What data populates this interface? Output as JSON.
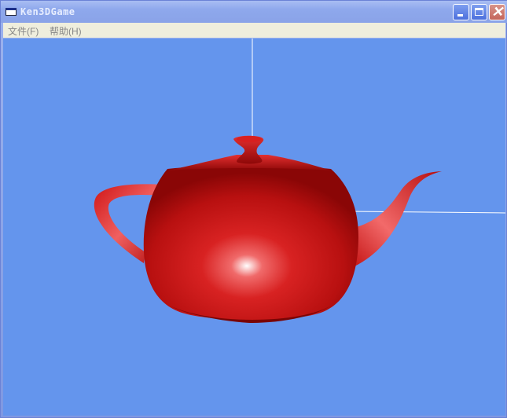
{
  "window": {
    "title": "Ken3DGame"
  },
  "menu": [
    {
      "label": "文件(F)"
    },
    {
      "label": "帮助(H)"
    }
  ],
  "scene": {
    "background": "#6495ED",
    "object": "teapot",
    "object_color": "#CC1010",
    "axis_color": "#FFFFFF"
  }
}
